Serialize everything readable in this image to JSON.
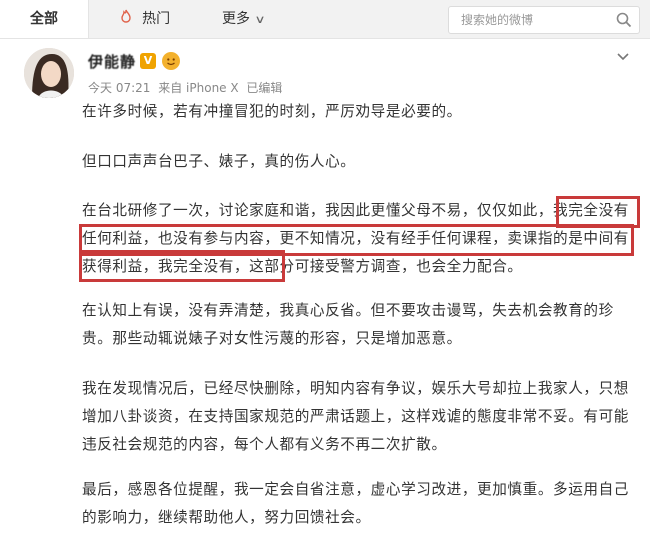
{
  "tabs": {
    "all": "全部",
    "hot": "热门",
    "more": "更多"
  },
  "search": {
    "placeholder": "搜索她的微博"
  },
  "post": {
    "author": "伊能静",
    "time": "今天 07:21",
    "source": "来自 iPhone X",
    "edited": "已编辑",
    "paragraphs": [
      "在许多时候，若有冲撞冒犯的时刻，严厉劝导是必要的。",
      "但口口声声台巴子、婊子，真的伤人心。",
      "在台北研修了一次，讨论家庭和谐，我因此更懂父母不易，仅仅如此，我完全没有任何利益，也没有参与内容，更不知情况，没有经手任何课程，卖课指的是中间有获得利益，我完全没有，这部分可接受警方调查，也会全力配合。",
      "在认知上有误，没有弄清楚，我真心反省。但不要攻击谩骂，失去机会教育的珍贵。那些动辄说婊子对女性污蔑的形容，只是增加恶意。",
      "我在发现情况后，已经尽快删除，明知内容有争议，娱乐大号却拉上我家人，只想增加八卦谈资，在支持国家规范的严肃话题上，这样戏谑的態度非常不妥。有可能违反社会规范的内容，每个人都有义务不再二次扩散。",
      "最后，感恩各位提醒，我一定会自省注意，虚心学习改进，更加慎重。多运用自己的影响力，继续帮助他人，努力回馈社会。"
    ]
  },
  "colors": {
    "highlight": "#c93a3a",
    "vip": "#f0a300"
  }
}
